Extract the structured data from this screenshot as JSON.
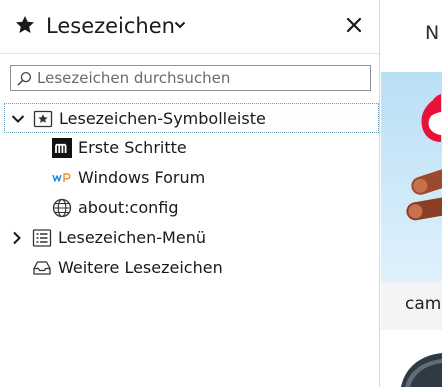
{
  "sidebar": {
    "title": "Lesezeichen",
    "search": {
      "placeholder": "Lesezeichen durchsuchen",
      "value": ""
    },
    "tree": [
      {
        "label": "Lesezeichen-Symbolleiste",
        "icon": "bookmarks-toolbar-icon",
        "expanded": true,
        "selected": true
      },
      {
        "label": "Erste Schritte",
        "icon": "m-site-icon"
      },
      {
        "label": "Windows Forum",
        "icon": "wp-site-icon"
      },
      {
        "label": "about:config",
        "icon": "globe-icon"
      },
      {
        "label": "Lesezeichen-Menü",
        "icon": "bookmarks-menu-icon",
        "expanded": false
      },
      {
        "label": "Weitere Lesezeichen",
        "icon": "other-bookmarks-icon"
      }
    ]
  },
  "page": {
    "header_text": "N",
    "strip_text": "camp"
  },
  "colors": {
    "selection_border": "#6b9fb7",
    "hero_sky": "#b9dff5",
    "flame": "#e8113a",
    "log": "#9c4a2c"
  }
}
